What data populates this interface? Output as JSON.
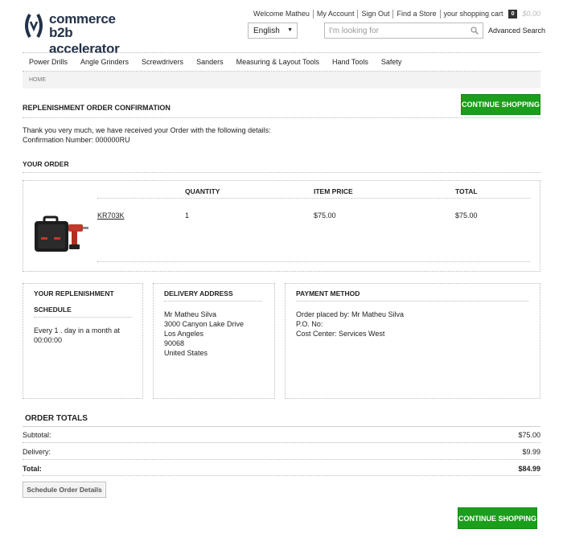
{
  "logo": {
    "line1": "commerce",
    "line2": "b2b accelerator"
  },
  "top_links": [
    "Welcome Matheu",
    "My Account",
    "Sign Out",
    "Find a Store",
    "your shopping cart"
  ],
  "cart": {
    "count": "0",
    "price": "$0.00"
  },
  "language": {
    "selected": "English"
  },
  "search": {
    "placeholder": "I'm looking for",
    "advanced_label": "Advanced Search"
  },
  "nav": [
    "Power Drills",
    "Angle Grinders",
    "Screwdrivers",
    "Sanders",
    "Measuring & Layout Tools",
    "Hand Tools",
    "Safety"
  ],
  "breadcrumb": "HOME",
  "page_title": "REPLENISHMENT ORDER CONFIRMATION",
  "continue_label": "CONTINUE SHOPPING",
  "thanks": {
    "line1": "Thank you very much, we have received your Order with the following details:",
    "line2": "Confirmation Number: 000000RU"
  },
  "your_order": {
    "title": "YOUR ORDER",
    "columns": {
      "quantity": "QUANTITY",
      "item_price": "ITEM PRICE",
      "total": "TOTAL"
    },
    "item": {
      "sku": "KR703K",
      "quantity": "1",
      "item_price": "$75.00",
      "total": "$75.00"
    }
  },
  "schedule": {
    "title1": "YOUR REPLENISHMENT",
    "title2": "SCHEDULE",
    "line1": "Every 1 . day in a month at",
    "line2": "00:00:00"
  },
  "delivery": {
    "title": "DELIVERY ADDRESS",
    "lines": [
      "Mr Matheu Silva",
      "3000 Canyon Lake Drive",
      "Los Angeles",
      "90068",
      "United States"
    ]
  },
  "payment": {
    "title": "PAYMENT METHOD",
    "lines": [
      "Order placed by: Mr Matheu Silva",
      "P.O. No:",
      "Cost Center: Services West"
    ]
  },
  "totals": {
    "title": "ORDER TOTALS",
    "subtotal_label": "Subtotal:",
    "subtotal": "$75.00",
    "delivery_label": "Delivery:",
    "delivery": "$9.99",
    "total_label": "Total:",
    "total": "$84.99"
  },
  "schedule_button": "Schedule Order Details",
  "colors": {
    "brand": "#23324a",
    "accent_green": "#1b9e1b"
  }
}
